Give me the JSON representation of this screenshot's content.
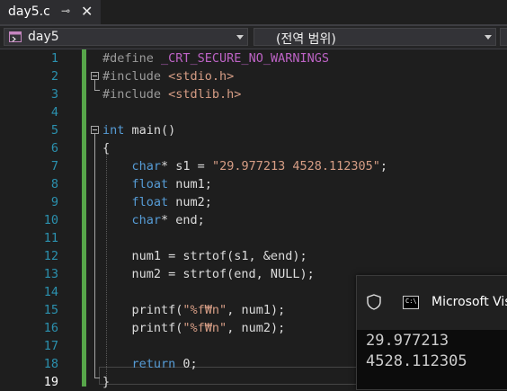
{
  "tab": {
    "title": "day5.c",
    "pin_glyph": "⊸",
    "close_glyph": "✕"
  },
  "navbar": {
    "project": "day5",
    "scope": "(전역 범위)"
  },
  "editor": {
    "line_numbers": [
      "1",
      "2",
      "3",
      "4",
      "5",
      "6",
      "7",
      "8",
      "9",
      "10",
      "11",
      "12",
      "13",
      "14",
      "15",
      "16",
      "17",
      "18",
      "19"
    ],
    "current_line": "19",
    "lines": [
      [
        {
          "t": "#define ",
          "c": "pp"
        },
        {
          "t": "_CRT_SECURE_NO_WARNINGS",
          "c": "macro"
        }
      ],
      [
        {
          "t": "#include ",
          "c": "pp"
        },
        {
          "t": "<stdio.h>",
          "c": "str"
        }
      ],
      [
        {
          "t": "#include ",
          "c": "pp"
        },
        {
          "t": "<stdlib.h>",
          "c": "str"
        }
      ],
      [],
      [
        {
          "t": "int",
          "c": "kw"
        },
        {
          "t": " main()",
          "c": ""
        }
      ],
      [
        {
          "t": "{",
          "c": ""
        }
      ],
      [
        {
          "t": "    ",
          "c": ""
        },
        {
          "t": "char",
          "c": "kw"
        },
        {
          "t": "* s1 = ",
          "c": ""
        },
        {
          "t": "\"29.977213 4528.112305\"",
          "c": "str"
        },
        {
          "t": ";",
          "c": ""
        }
      ],
      [
        {
          "t": "    ",
          "c": ""
        },
        {
          "t": "float",
          "c": "kw"
        },
        {
          "t": " num1;",
          "c": ""
        }
      ],
      [
        {
          "t": "    ",
          "c": ""
        },
        {
          "t": "float",
          "c": "kw"
        },
        {
          "t": " num2;",
          "c": ""
        }
      ],
      [
        {
          "t": "    ",
          "c": ""
        },
        {
          "t": "char",
          "c": "kw"
        },
        {
          "t": "* end;",
          "c": ""
        }
      ],
      [],
      [
        {
          "t": "    num1 = strtof(s1, &end);",
          "c": ""
        }
      ],
      [
        {
          "t": "    num2 = strtof(end, NULL);",
          "c": ""
        }
      ],
      [],
      [
        {
          "t": "    printf(",
          "c": ""
        },
        {
          "t": "\"%f₩n\"",
          "c": "str"
        },
        {
          "t": ", num1);",
          "c": ""
        }
      ],
      [
        {
          "t": "    printf(",
          "c": ""
        },
        {
          "t": "\"%f₩n\"",
          "c": "str"
        },
        {
          "t": ", num2);",
          "c": ""
        }
      ],
      [],
      [
        {
          "t": "    ",
          "c": ""
        },
        {
          "t": "return",
          "c": "kw"
        },
        {
          "t": " 0;",
          "c": ""
        }
      ],
      [
        {
          "t": "}",
          "c": ""
        }
      ]
    ]
  },
  "console": {
    "title": "Microsoft Vis",
    "icon_label": "C:\\",
    "output": [
      "29.977213",
      "4528.112305"
    ]
  },
  "colors": {
    "keyword": "#569cd6",
    "preprocessor": "#9b9b9b",
    "string": "#d69d85",
    "macro": "#bd63c5",
    "line_number": "#2b91af",
    "change_bar": "#57a64a"
  }
}
